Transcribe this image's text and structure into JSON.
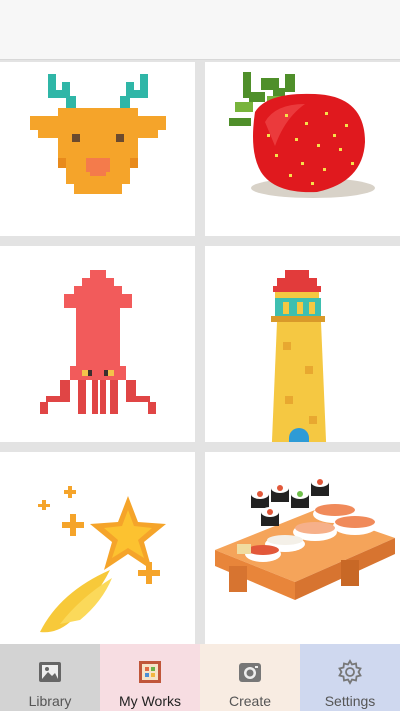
{
  "app": {
    "title": ""
  },
  "gallery": {
    "items": [
      {
        "name": "deer",
        "icon": "reindeer-pixel-art"
      },
      {
        "name": "strawberry",
        "icon": "strawberry-pixel-art"
      },
      {
        "name": "squid",
        "icon": "squid-pixel-art"
      },
      {
        "name": "lighthouse",
        "icon": "lighthouse-pixel-art"
      },
      {
        "name": "shooting-star",
        "icon": "shooting-star-pixel-art"
      },
      {
        "name": "sushi",
        "icon": "sushi-platter-pixel-art"
      }
    ]
  },
  "nav": {
    "items": [
      {
        "label": "Library",
        "icon": "image-icon",
        "bg": "#d3d3d3"
      },
      {
        "label": "My Works",
        "icon": "stamp-icon",
        "bg": "#f7dde2",
        "active": true
      },
      {
        "label": "Create",
        "icon": "camera-icon",
        "bg": "#f8ece2"
      },
      {
        "label": "Settings",
        "icon": "gear-icon",
        "bg": "#cfd8ef"
      }
    ]
  }
}
